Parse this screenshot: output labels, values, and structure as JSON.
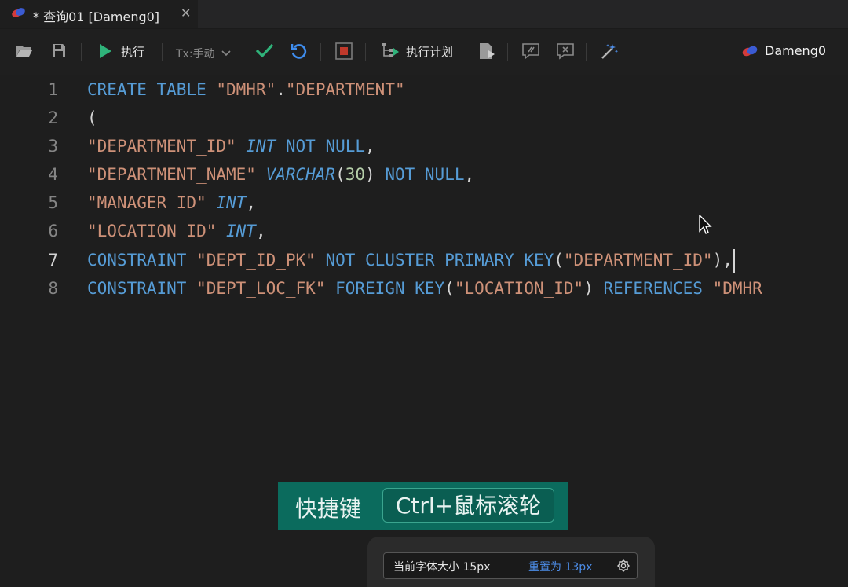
{
  "tab": {
    "title": "* 查询01 [Dameng0]",
    "close": "✕"
  },
  "toolbar": {
    "execute_label": "执行",
    "tx_label": "Tx:手动",
    "plan_label": "执行计划",
    "connection_label": "Dameng0"
  },
  "editor": {
    "line_numbers": [
      "1",
      "2",
      "3",
      "4",
      "5",
      "6",
      "7",
      "8"
    ],
    "active_line": "7",
    "lines": [
      [
        {
          "t": "kw",
          "v": "CREATE TABLE "
        },
        {
          "t": "str",
          "v": "\"DMHR\""
        },
        {
          "t": "pun",
          "v": "."
        },
        {
          "t": "str",
          "v": "\"DEPARTMENT\""
        }
      ],
      [
        {
          "t": "pun",
          "v": "("
        }
      ],
      [
        {
          "t": "str",
          "v": "\"DEPARTMENT_ID\" "
        },
        {
          "t": "typ",
          "v": "INT"
        },
        {
          "t": "kw",
          "v": " NOT NULL"
        },
        {
          "t": "pun",
          "v": ","
        }
      ],
      [
        {
          "t": "str",
          "v": "\"DEPARTMENT_NAME\" "
        },
        {
          "t": "typ",
          "v": "VARCHAR"
        },
        {
          "t": "pun",
          "v": "("
        },
        {
          "t": "num",
          "v": "30"
        },
        {
          "t": "pun",
          "v": ") "
        },
        {
          "t": "kw",
          "v": "NOT NULL"
        },
        {
          "t": "pun",
          "v": ","
        }
      ],
      [
        {
          "t": "str",
          "v": "\"MANAGER ID\" "
        },
        {
          "t": "typ",
          "v": "INT"
        },
        {
          "t": "pun",
          "v": ","
        }
      ],
      [
        {
          "t": "str",
          "v": "\"LOCATION ID\" "
        },
        {
          "t": "typ",
          "v": "INT"
        },
        {
          "t": "pun",
          "v": ","
        }
      ],
      [
        {
          "t": "kw",
          "v": "CONSTRAINT "
        },
        {
          "t": "str",
          "v": "\"DEPT_ID_PK\" "
        },
        {
          "t": "kw",
          "v": "NOT CLUSTER PRIMARY KEY"
        },
        {
          "t": "pun",
          "v": "("
        },
        {
          "t": "str",
          "v": "\"DEPARTMENT_ID\""
        },
        {
          "t": "pun",
          "v": "),"
        }
      ],
      [
        {
          "t": "kw",
          "v": "CONSTRAINT "
        },
        {
          "t": "str",
          "v": "\"DEPT_LOC_FK\" "
        },
        {
          "t": "kw",
          "v": "FOREIGN KEY"
        },
        {
          "t": "pun",
          "v": "("
        },
        {
          "t": "str",
          "v": "\"LOCATION_ID\""
        },
        {
          "t": "pun",
          "v": ") "
        },
        {
          "t": "kw",
          "v": "REFERENCES "
        },
        {
          "t": "str",
          "v": "\"DMHR"
        }
      ]
    ]
  },
  "hint": {
    "prefix": "快捷键",
    "shortcut": "Ctrl+鼠标滚轮"
  },
  "fontbar": {
    "current_label": "当前字体大小 15px",
    "reset_label": "重置为 13px"
  },
  "colors": {
    "keyword": "#569cd6",
    "string": "#ce9178",
    "number": "#b5cea8",
    "run_green": "#2fb37a",
    "hint_bg": "#0b6b5d",
    "link_blue": "#4d8de8"
  },
  "icons": [
    "dameng-logo-icon",
    "folder-open-icon",
    "save-icon",
    "play-icon",
    "chevron-down-icon",
    "check-icon",
    "undo-icon",
    "stop-icon",
    "execution-plan-icon",
    "explain-icon",
    "comment-icon",
    "uncomment-icon",
    "magic-wand-icon",
    "mouse-pointer-icon",
    "gear-icon"
  ]
}
